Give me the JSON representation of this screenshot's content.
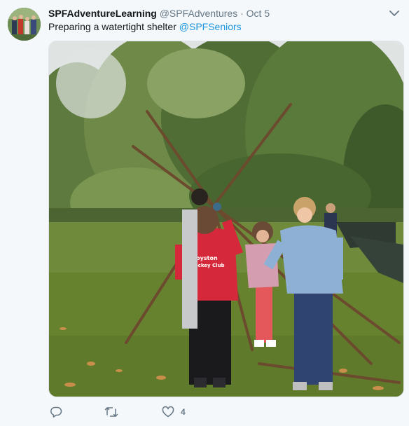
{
  "tweet": {
    "display_name": "SPFAdventureLearning",
    "handle": "@SPFAdventures",
    "separator": "·",
    "date": "Oct 5",
    "text": "Preparing a watertight shelter",
    "mention": "@SPFSeniors",
    "media": {
      "jacket_text_line1": "Royston",
      "jacket_text_line2": "Hockey Club"
    },
    "actions": {
      "reply_icon": "reply-icon",
      "retweet_icon": "retweet-icon",
      "like_icon": "heart-icon",
      "like_count": "4"
    },
    "colors": {
      "link": "#1b95e0",
      "name": "#14171a",
      "meta": "#657786",
      "background": "#f5f8fa"
    }
  }
}
